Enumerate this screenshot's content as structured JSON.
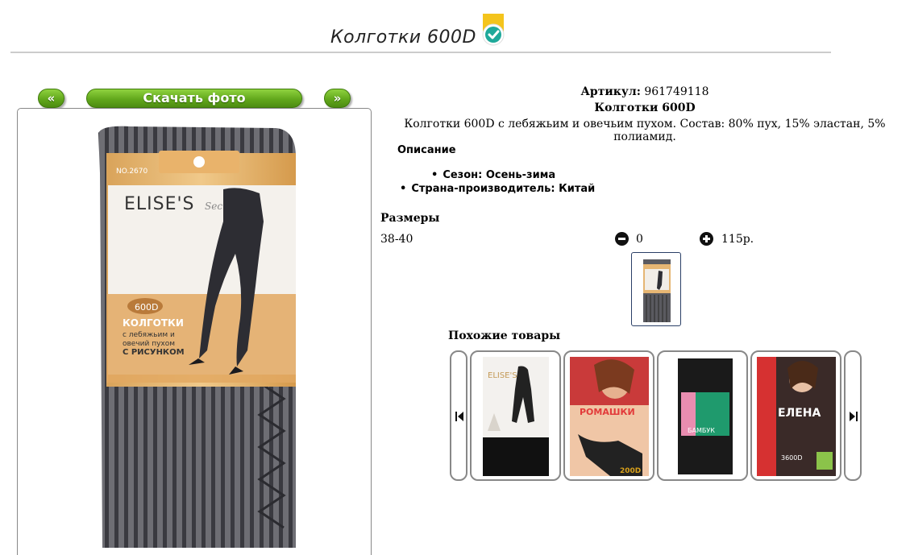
{
  "product": {
    "title": "Колготки 600D",
    "article_label": "Артикул:",
    "article_value": "961749118",
    "name": "Колготки 600D",
    "description": "Колготки 600D с лебяжьим и овечьим пухом. Состав: 80% пух, 15% эластан, 5% полиамид."
  },
  "nav": {
    "prev_label": "«",
    "download_label": "Скачать фото",
    "next_label": "»"
  },
  "packaging": {
    "model_no": "NO.2670",
    "brand": "ELISE'S",
    "brand_suffix": "Secret",
    "density": "600D",
    "line1": "КОЛГОТКИ",
    "line2": "с лебяжьим и",
    "line3": "овечий пухом",
    "line4": "С РИСУНКОМ"
  },
  "details": {
    "heading": "Описание",
    "season": "Сезон: Осень-зима",
    "country": "Страна-производитель: Китай"
  },
  "sizes": {
    "heading": "Размеры",
    "rows": [
      {
        "size": "38-40",
        "quantity": "0",
        "price": "115р."
      }
    ]
  },
  "similar": {
    "heading": "Похожие товары",
    "items": [
      {
        "brand": "ELISE'S"
      },
      {
        "brand": "РОМАШКИ",
        "badge": "200D"
      },
      {
        "brand": "БАМБУК"
      },
      {
        "brand": "ЕЛЕНА",
        "badge": "3600D"
      }
    ]
  },
  "colors": {
    "accent_green": "#62a81c",
    "badge_yellow": "#f4c41c",
    "badge_teal": "#1fa99a"
  }
}
